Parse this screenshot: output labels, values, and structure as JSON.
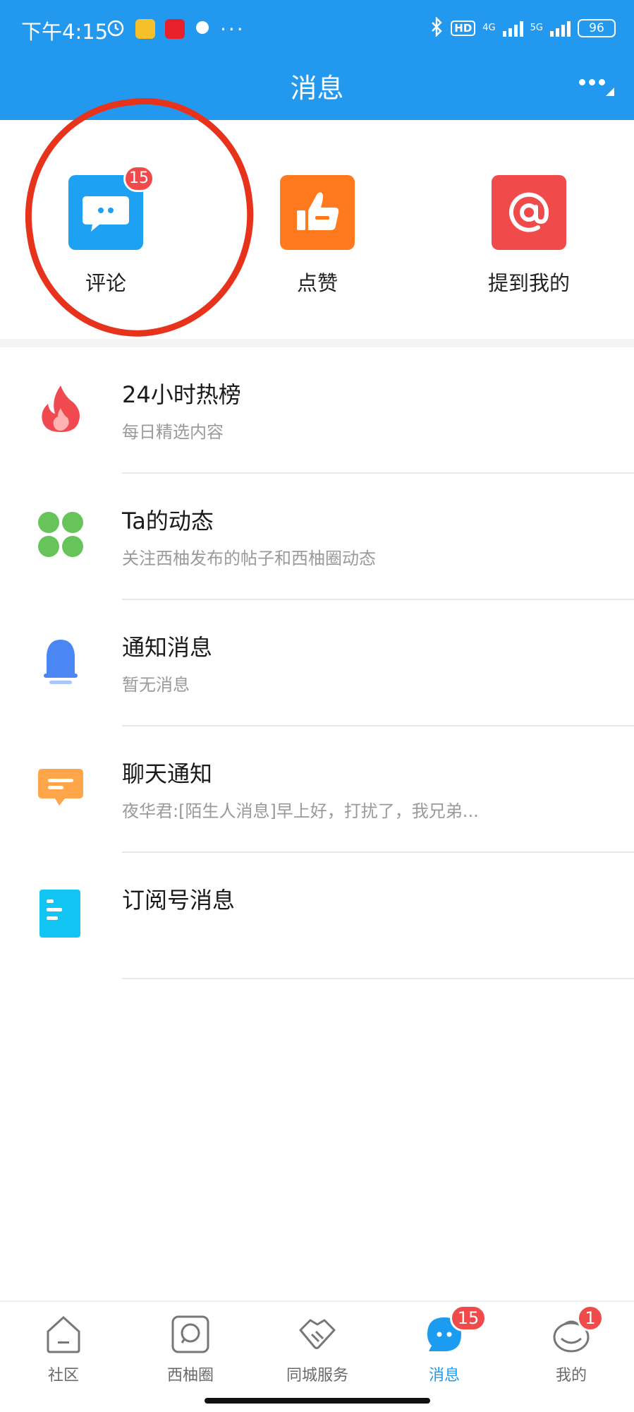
{
  "status_bar": {
    "time": "下午4:15",
    "hd": "HD",
    "net_4g": "4G",
    "net_5g": "5G",
    "battery": "96"
  },
  "header": {
    "title": "消息"
  },
  "actions": [
    {
      "label": "评论",
      "badge": "15",
      "icon": "comment-icon",
      "color": "#1da1f2"
    },
    {
      "label": "点赞",
      "icon": "thumbs-up-icon",
      "color": "#ff7a1f"
    },
    {
      "label": "提到我的",
      "icon": "at-icon",
      "color": "#f04a4a"
    }
  ],
  "list": [
    {
      "title": "24小时热榜",
      "subtitle": "每日精选内容",
      "icon": "flame-icon"
    },
    {
      "title": "Ta的动态",
      "subtitle": "关注西柚发布的帖子和西柚圈动态",
      "icon": "clover-icon"
    },
    {
      "title": "通知消息",
      "subtitle": "暂无消息",
      "icon": "bell-icon"
    },
    {
      "title": "聊天通知",
      "subtitle": "夜华君:[陌生人消息]早上好，打扰了，我兄弟...",
      "icon": "chat-bubble-icon"
    },
    {
      "title": "订阅号消息",
      "subtitle": "",
      "icon": "document-icon"
    }
  ],
  "bottom_nav": [
    {
      "label": "社区",
      "icon": "home-icon",
      "active": false
    },
    {
      "label": "西柚圈",
      "icon": "circle-square-icon",
      "active": false
    },
    {
      "label": "同城服务",
      "icon": "handshake-icon",
      "active": false
    },
    {
      "label": "消息",
      "icon": "message-icon",
      "active": true,
      "badge": "15"
    },
    {
      "label": "我的",
      "icon": "profile-icon",
      "active": false,
      "badge": "1"
    }
  ],
  "colors": {
    "header_bg": "#2299ee",
    "badge": "#f04a4a",
    "active_tab": "#1c9cf0",
    "annotation_circle": "#e8331c"
  }
}
